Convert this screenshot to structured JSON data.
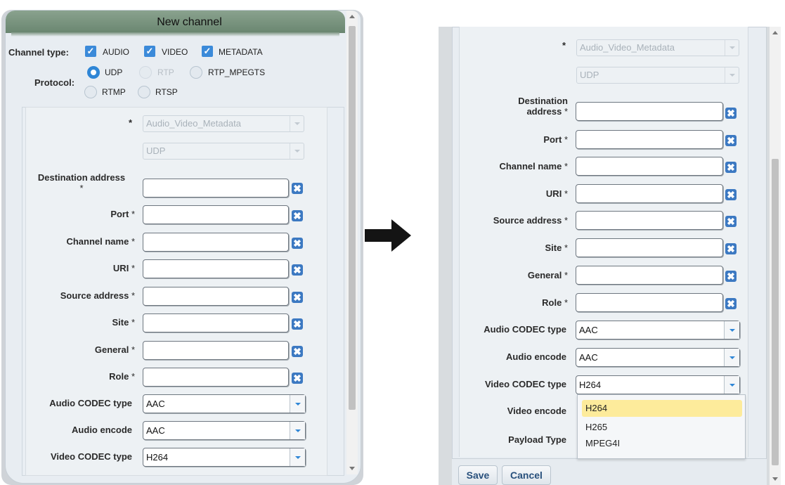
{
  "dialog": {
    "title": "New channel",
    "channel_type_label": "Channel type:",
    "channel_types": [
      {
        "label": "AUDIO",
        "checked": true
      },
      {
        "label": "VIDEO",
        "checked": true
      },
      {
        "label": "METADATA",
        "checked": true
      }
    ],
    "protocol_label": "Protocol:",
    "protocols": [
      {
        "label": "UDP",
        "state": "selected"
      },
      {
        "label": "RTP",
        "state": "disabled"
      },
      {
        "label": "RTP_MPEGTS",
        "state": "unselected"
      },
      {
        "label": "RTMP",
        "state": "unselected"
      },
      {
        "label": "RTSP",
        "state": "unselected"
      }
    ]
  },
  "form": {
    "template_asterisk": "*",
    "template_value": "Audio_Video_Metadata",
    "protocol_value": "UDP",
    "required_mark": "*",
    "fields": [
      {
        "label": "Destination address",
        "label_right_line1": "Destination",
        "label_right_line2": "address",
        "value": ""
      },
      {
        "label": "Port",
        "value": ""
      },
      {
        "label": "Channel name",
        "value": ""
      },
      {
        "label": "URI",
        "value": ""
      },
      {
        "label": "Source address",
        "value": ""
      },
      {
        "label": "Site",
        "value": ""
      },
      {
        "label": "General",
        "value": ""
      },
      {
        "label": "Role",
        "value": ""
      }
    ],
    "combos": [
      {
        "label": "Audio CODEC type",
        "value": "AAC"
      },
      {
        "label": "Audio encode",
        "value": "AAC"
      },
      {
        "label": "Video CODEC type",
        "value": "H264"
      },
      {
        "label": "Video encode",
        "value": ""
      },
      {
        "label": "Payload Type",
        "value": ""
      }
    ],
    "clear_glyph": "✖"
  },
  "video_codec_options": [
    {
      "label": "H264",
      "highlighted": true
    },
    {
      "label": "H265",
      "highlighted": false
    },
    {
      "label": "MPEG4I",
      "highlighted": false
    }
  ],
  "buttons": {
    "save": "Save",
    "cancel": "Cancel"
  },
  "colors": {
    "titlebar": "#7a947f",
    "checkbox": "#3b8ad9",
    "clear_icon": "#3c79c2",
    "highlight": "#fdeb9b",
    "button_text": "#28507c"
  },
  "arrow_icon": "right-arrow-icon"
}
